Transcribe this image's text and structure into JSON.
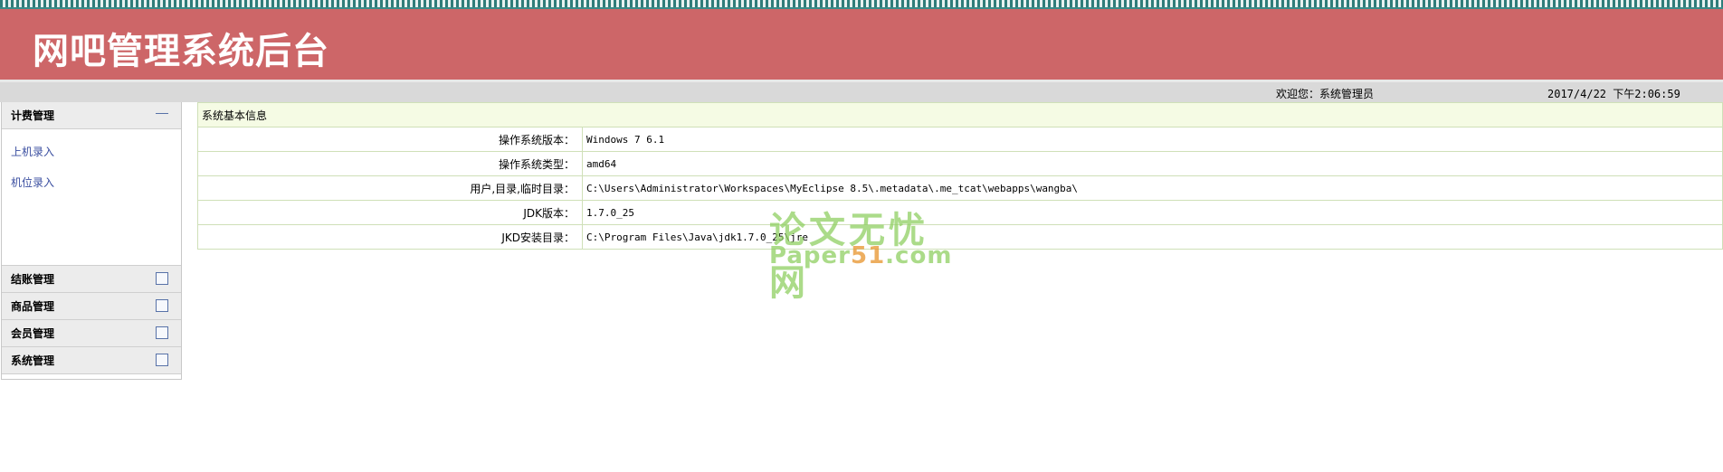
{
  "header": {
    "title": "网吧管理系统后台"
  },
  "statusbar": {
    "welcome": "欢迎您：系统管理员",
    "datetime": "2017/4/22 下午2:06:59"
  },
  "sidebar": {
    "expanded": {
      "label": "计费管理",
      "links": [
        "上机录入",
        "机位录入"
      ]
    },
    "collapsed": [
      "结账管理",
      "商品管理",
      "会员管理",
      "系统管理"
    ]
  },
  "info": {
    "caption": "系统基本信息",
    "rows": [
      {
        "label": "操作系统版本：",
        "value": "Windows 7    6.1"
      },
      {
        "label": "操作系统类型：",
        "value": "amd64"
      },
      {
        "label": "用户,目录,临时目录：",
        "value": "C:\\Users\\Administrator\\Workspaces\\MyEclipse 8.5\\.metadata\\.me_tcat\\webapps\\wangba\\"
      },
      {
        "label": "JDK版本：",
        "value": "1.7.0_25"
      },
      {
        "label": "JKD安装目录：",
        "value": "C:\\Program Files\\Java\\jdk1.7.0_25\\jre"
      }
    ]
  },
  "watermark": {
    "line1": "论文无忧网",
    "line2_a": "Paper",
    "line2_b": "51",
    "line2_c": ".com"
  }
}
